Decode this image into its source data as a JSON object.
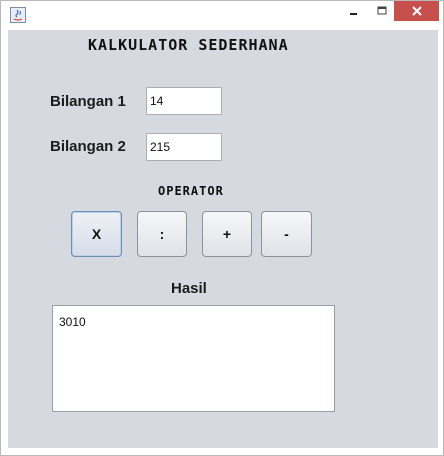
{
  "window": {
    "title": "",
    "controls": {
      "minimize": "minimize-icon",
      "maximize": "maximize-icon",
      "close": "close-icon"
    },
    "close_color": "#c7504d",
    "background": "#d6d9e0"
  },
  "app": {
    "title": "KALKULATOR SEDERHANA",
    "bilangan1": {
      "label": "Bilangan 1",
      "value": "14"
    },
    "bilangan2": {
      "label": "Bilangan 2",
      "value": "215"
    },
    "operator_label": "OPERATOR",
    "operators": [
      {
        "label": "X",
        "name": "multiply"
      },
      {
        "label": ":",
        "name": "divide"
      },
      {
        "label": "+",
        "name": "add"
      },
      {
        "label": "-",
        "name": "subtract"
      }
    ],
    "hasil_label": "Hasil",
    "hasil_value": "3010"
  }
}
